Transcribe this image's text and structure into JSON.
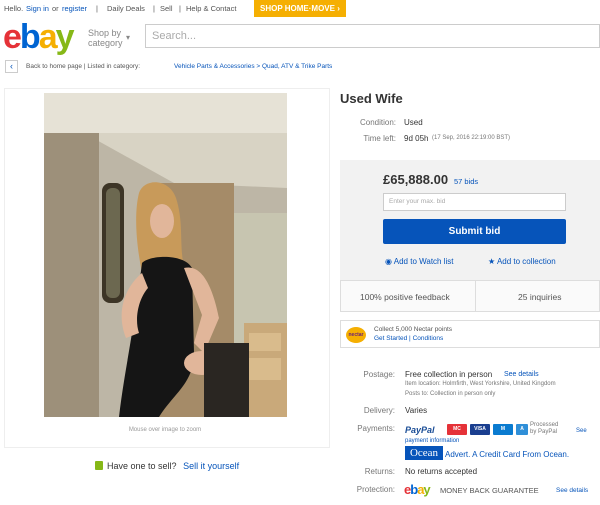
{
  "topbar": {
    "hello": "Hello.",
    "signin": "Sign in",
    "or": "or",
    "register": "register",
    "daily_deals": "Daily Deals",
    "sell": "Sell",
    "help": "Help & Contact",
    "promo": "SHOP HOME·MOVE ›"
  },
  "header": {
    "logo": [
      "e",
      "b",
      "a",
      "y"
    ],
    "shop_by": "Shop by",
    "category": "category",
    "search_placeholder": "Search..."
  },
  "breadcrumb": {
    "back": "Back to home page",
    "listed_in": "Listed in category:",
    "path": "Vehicle Parts & Accessories > Quad, ATV & Trike Parts"
  },
  "image_panel": {
    "zoom_hint": "Mouse over image to zoom",
    "have_one": "Have one to sell?",
    "sell_it": "Sell it yourself"
  },
  "listing": {
    "title": "Used Wife",
    "condition_label": "Condition:",
    "condition_value": "Used",
    "time_left_label": "Time left:",
    "time_left_value": "9d 05h",
    "time_left_detail": "(17 Sep, 2016  22:19:00 BST)"
  },
  "bid": {
    "price": "£65,888.00",
    "bids": "57 bids",
    "max_bid_placeholder": "Enter your max. bid",
    "submit": "Submit bid",
    "watch": "Add to Watch list",
    "collection": "Add to collection"
  },
  "seller": {
    "feedback": "100% positive feedback",
    "inquiries": "25 inquiries"
  },
  "nectar": {
    "logo": "nectar",
    "line1": "Collect 5,000 Nectar points",
    "get_started": "Get Started",
    "conditions": "Conditions"
  },
  "details": {
    "postage_label": "Postage:",
    "postage_value": "Free collection in person",
    "see_details": "See details",
    "location": "Item location:  Holmfirth, West Yorkshire, United Kingdom",
    "posts_to": "Posts to:  Collection in person only",
    "delivery_label": "Delivery:",
    "delivery_value": "Varies",
    "payments_label": "Payments:",
    "paypal": "PayPal",
    "processed": "Processed by PayPal",
    "see": "See",
    "payment_info": "payment information",
    "ocean": "Ocean",
    "ocean_advert": "Advert. A Credit Card From Ocean.",
    "returns_label": "Returns:",
    "returns_value": "No returns accepted",
    "protection_label": "Protection:",
    "guarantee": "MONEY BACK GUARANTEE",
    "see_details2": "See details"
  },
  "colors": {
    "ebay_red": "#e53238",
    "ebay_blue": "#0064d2",
    "ebay_yellow": "#f5af02",
    "ebay_green": "#86b817",
    "link": "#0654ba"
  }
}
